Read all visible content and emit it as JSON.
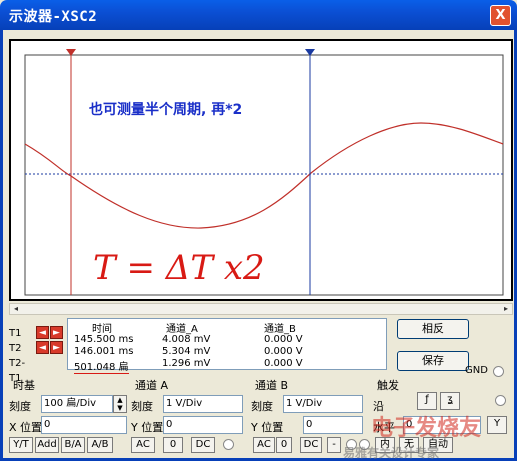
{
  "window": {
    "title": "示波器-XSC2",
    "close_label": "X"
  },
  "screen": {
    "annotation_text": "也可测量半个周期, 再*2",
    "handwritten": "T = ΔT x2"
  },
  "measure": {
    "headers": [
      "时间",
      "通道_A",
      "通道_B"
    ],
    "rows": [
      {
        "label": "T1",
        "time": "145.500 ms",
        "a": "4.008 mV",
        "b": "0.000 V"
      },
      {
        "label": "T2",
        "time": "146.001 ms",
        "a": "5.304 mV",
        "b": "0.000 V"
      },
      {
        "label": "T2-T1",
        "time": "501.048 扁",
        "a": "1.296 mV",
        "b": "0.000 V"
      }
    ]
  },
  "buttons": {
    "reverse": "相反",
    "save": "保存",
    "gnd": "GND"
  },
  "timebase": {
    "title": "时基",
    "scale_label": "刻度",
    "scale_value": "100 扁/Div",
    "xpos_label": "X 位置",
    "xpos_value": "0",
    "modes": [
      "Y/T",
      "Add",
      "B/A",
      "A/B"
    ]
  },
  "channel_a": {
    "title": "通道 A",
    "scale_label": "刻度",
    "scale_value": "1  V/Div",
    "ypos_label": "Y 位置",
    "ypos_value": "0",
    "coupling": [
      "AC",
      "0",
      "DC"
    ]
  },
  "channel_b": {
    "title": "通道 B",
    "scale_label": "刻度",
    "scale_value": "1  V/Div",
    "ypos_label": "Y 位置",
    "ypos_value": "0",
    "coupling": [
      "AC",
      "0",
      "DC",
      "-"
    ]
  },
  "trigger": {
    "title": "触发",
    "edge_label": "沿",
    "level_label": "水平",
    "level_value": "0",
    "modes": [
      "内",
      "无",
      "自动"
    ],
    "y_label": "Y"
  },
  "watermark": {
    "line1": "电子发烧友",
    "line2": "易雅有关设计专家"
  },
  "colors": {
    "title_bar": "#0a5fe8",
    "trace": "#c0302a",
    "cursor1": "#c0302a",
    "cursor2": "#1a3aa0",
    "annotation": "#1a2fc8"
  }
}
